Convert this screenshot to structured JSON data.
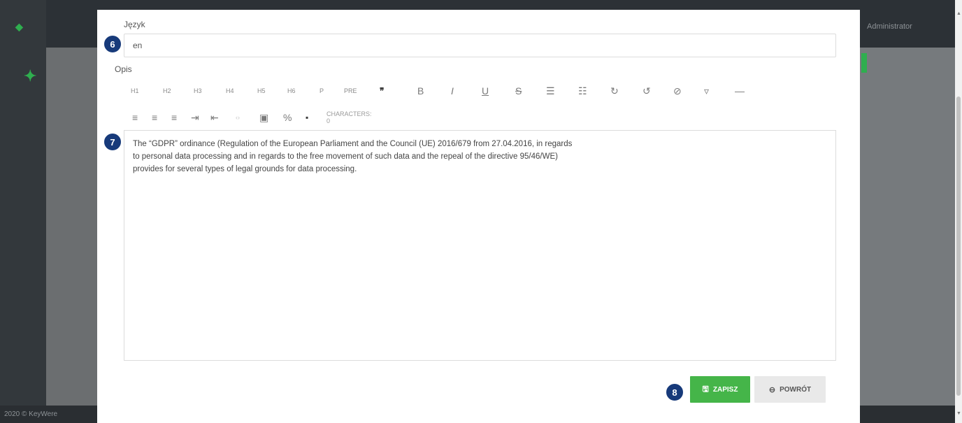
{
  "backdrop": {
    "copyright": "2020 © KeyWere",
    "user": "Administrator"
  },
  "form": {
    "language_label": "Język",
    "language_value": "en",
    "description_label": "Opis",
    "description_text": "The “GDPR” ordinance (Regulation of the European Parliament and the Council (UE) 2016/679 from 27.04.2016, in regards to personal data processing and in regards to the free movement of such data and the repeal of the directive 95/46/WE) provides for several types of legal grounds for data processing."
  },
  "toolbar": {
    "row1": [
      "H1",
      "H2",
      "H3",
      "H4",
      "H5",
      "H6",
      "P",
      "PRE"
    ],
    "quote_icon": "quote-icon",
    "bold": "B",
    "italic": "I",
    "underline": "U",
    "strikethrough": "S",
    "char_count": "CHARACTERS: 0"
  },
  "buttons": {
    "save_label": "ZAPISZ",
    "back_label": "POWRÓT"
  },
  "badges": {
    "b6": "6",
    "b7": "7",
    "b8": "8"
  },
  "colors": {
    "save": "#45b549",
    "badge": "#173a7a",
    "brand_green": "#2fae4f"
  }
}
